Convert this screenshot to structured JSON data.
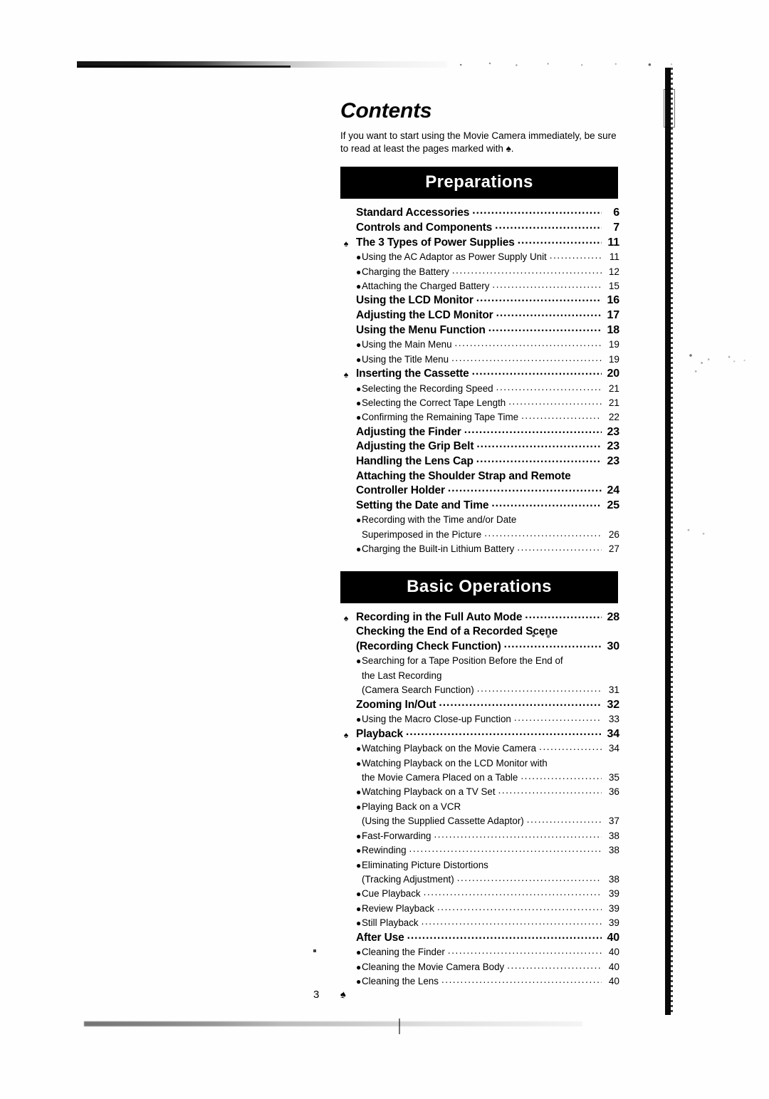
{
  "document": {
    "title": "Contents",
    "intro": "If you want to start using the Movie Camera immediately, be sure to read at least the pages marked with ♠.",
    "page_number": "3",
    "footer_mark": "♠"
  },
  "markers": {
    "spade": "♠",
    "bullet": "●"
  },
  "sections": [
    {
      "heading": "Preparations",
      "entries": [
        {
          "type": "major",
          "mark": "",
          "label": "Standard Accessories",
          "page": "6"
        },
        {
          "type": "major",
          "mark": "",
          "label": "Controls and Components",
          "page": "7"
        },
        {
          "type": "major",
          "mark": "♠",
          "label": "The 3 Types of Power Supplies",
          "page": "11"
        },
        {
          "type": "sub",
          "label": "Using the AC Adaptor as Power Supply Unit",
          "page": "11",
          "leader": false
        },
        {
          "type": "sub",
          "label": "Charging the Battery",
          "page": "12"
        },
        {
          "type": "sub",
          "label": "Attaching the Charged Battery",
          "page": "15"
        },
        {
          "type": "major",
          "mark": "",
          "label": "Using the LCD Monitor",
          "page": "16"
        },
        {
          "type": "major",
          "mark": "",
          "label": "Adjusting the LCD Monitor",
          "page": "17"
        },
        {
          "type": "major",
          "mark": "",
          "label": "Using the Menu Function",
          "page": "18"
        },
        {
          "type": "sub",
          "label": "Using the Main Menu",
          "page": "19"
        },
        {
          "type": "sub",
          "label": "Using the Title Menu",
          "page": "19"
        },
        {
          "type": "major",
          "mark": "♠",
          "label": "Inserting the Cassette",
          "page": "20"
        },
        {
          "type": "sub",
          "label": "Selecting the Recording Speed",
          "page": "21"
        },
        {
          "type": "sub",
          "label": "Selecting the Correct Tape Length",
          "page": "21"
        },
        {
          "type": "sub",
          "label": "Confirming the Remaining Tape Time",
          "page": "22"
        },
        {
          "type": "major",
          "mark": "",
          "label": "Adjusting the Finder",
          "page": "23"
        },
        {
          "type": "major",
          "mark": "",
          "label": "Adjusting the Grip Belt",
          "page": "23"
        },
        {
          "type": "major",
          "mark": "",
          "label": "Handling the Lens Cap",
          "page": "23"
        },
        {
          "type": "major-nopage",
          "mark": "",
          "label": "Attaching the Shoulder Strap and Remote"
        },
        {
          "type": "major",
          "mark": "",
          "label": "Controller Holder",
          "page": "24"
        },
        {
          "type": "major",
          "mark": "",
          "label": "Setting the Date and Time",
          "page": "25"
        },
        {
          "type": "sub-nopage",
          "label": "Recording with the Time and/or Date"
        },
        {
          "type": "sub-cont",
          "label": "Superimposed in the Picture",
          "page": "26"
        },
        {
          "type": "sub",
          "label": "Charging the Built-in Lithium Battery",
          "page": "27"
        }
      ]
    },
    {
      "heading": "Basic Operations",
      "entries": [
        {
          "type": "major",
          "mark": "♠",
          "label": "Recording in the Full Auto Mode",
          "page": "28"
        },
        {
          "type": "major-nopage",
          "mark": "",
          "label": "Checking the End of a Recorded Scene"
        },
        {
          "type": "major",
          "mark": "",
          "label": "(Recording Check Function)",
          "page": "30"
        },
        {
          "type": "sub-nopage",
          "label": "Searching for a Tape Position Before the End of"
        },
        {
          "type": "sub-cont-nopage",
          "label": "the Last Recording"
        },
        {
          "type": "sub-cont",
          "label": "(Camera Search Function)",
          "page": "31"
        },
        {
          "type": "major",
          "mark": "",
          "label": "Zooming In/Out",
          "page": "32"
        },
        {
          "type": "sub",
          "label": "Using the Macro Close-up Function",
          "page": "33"
        },
        {
          "type": "major",
          "mark": "♠",
          "label": "Playback",
          "page": "34"
        },
        {
          "type": "sub",
          "label": "Watching Playback on the Movie Camera",
          "page": "34"
        },
        {
          "type": "sub-nopage",
          "label": "Watching Playback on the LCD Monitor with"
        },
        {
          "type": "sub-cont",
          "label": "the Movie Camera Placed on a Table",
          "page": "35"
        },
        {
          "type": "sub",
          "label": "Watching Playback on a TV Set",
          "page": "36"
        },
        {
          "type": "sub-nopage",
          "label": "Playing Back on a VCR"
        },
        {
          "type": "sub-cont",
          "label": "(Using the Supplied Cassette Adaptor)",
          "page": "37"
        },
        {
          "type": "sub",
          "label": "Fast-Forwarding",
          "page": "38"
        },
        {
          "type": "sub",
          "label": "Rewinding",
          "page": "38"
        },
        {
          "type": "sub-nopage",
          "label": "Eliminating Picture Distortions"
        },
        {
          "type": "sub-cont",
          "label": "(Tracking Adjustment)",
          "page": "38"
        },
        {
          "type": "sub",
          "label": "Cue Playback",
          "page": "39"
        },
        {
          "type": "sub",
          "label": "Review Playback",
          "page": "39"
        },
        {
          "type": "sub",
          "label": "Still Playback",
          "page": "39"
        },
        {
          "type": "major",
          "mark": "",
          "label": "After Use",
          "page": "40"
        },
        {
          "type": "sub",
          "label": "Cleaning the Finder",
          "page": "40"
        },
        {
          "type": "sub",
          "label": "Cleaning the Movie Camera Body",
          "page": "40"
        },
        {
          "type": "sub",
          "label": "Cleaning the Lens",
          "page": "40"
        }
      ]
    }
  ]
}
